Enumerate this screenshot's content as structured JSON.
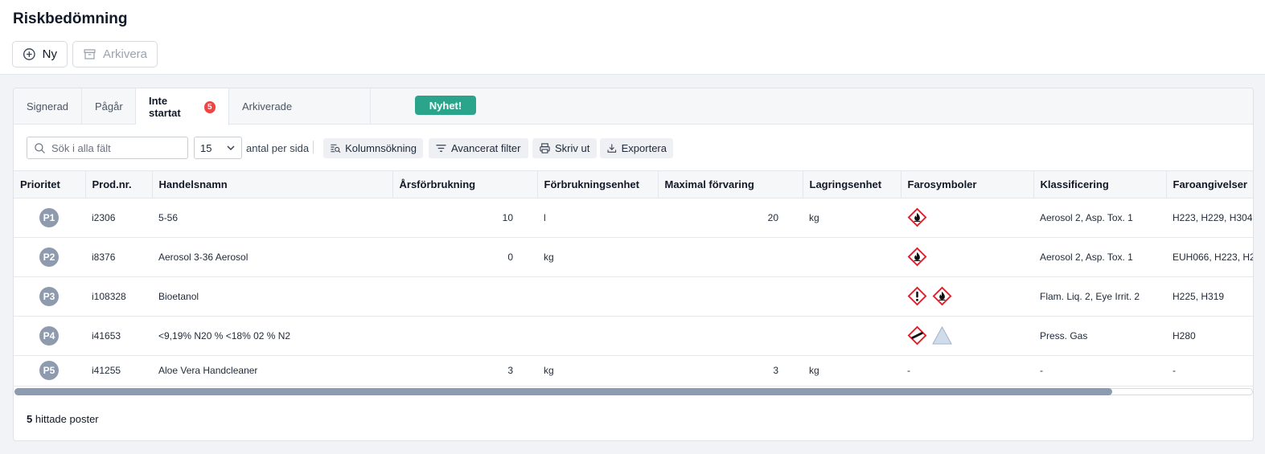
{
  "page": {
    "title": "Riskbedömning"
  },
  "actions": {
    "new_label": "Ny",
    "archive_label": "Arkivera"
  },
  "tabs": [
    {
      "label": "Signerad"
    },
    {
      "label": "Pågår"
    },
    {
      "label": "Inte startat",
      "badge": "5"
    },
    {
      "label": "Arkiverade"
    }
  ],
  "news_label": "Nyhet!",
  "toolbar": {
    "search_placeholder": "Sök i alla fält",
    "per_page_value": "15",
    "per_page_label": "antal per sida",
    "column_search": "Kolumnsökning",
    "advanced_filter": "Avancerat filter",
    "print": "Skriv ut",
    "export": "Exportera"
  },
  "table": {
    "headers": [
      "Prioritet",
      "Prod.nr.",
      "Handelsnamn",
      "Årsförbrukning",
      "Förbrukningsenhet",
      "Maximal förvaring",
      "Lagringsenhet",
      "Farosymboler",
      "Klassificering",
      "Faroangivelser"
    ],
    "rows": [
      {
        "prio": "P1",
        "prod": "i2306",
        "name": "5-56",
        "annual": "10",
        "annual_unit": "l",
        "max": "20",
        "storage_unit": "kg",
        "symbols": [
          "flame"
        ],
        "class": "Aerosol 2, Asp. Tox. 1",
        "hazards": "H223, H229, H304,"
      },
      {
        "prio": "P2",
        "prod": "i8376",
        "name": "Aerosol 3-36 Aerosol",
        "annual": "0",
        "annual_unit": "kg",
        "max": "",
        "storage_unit": "",
        "symbols": [
          "flame"
        ],
        "class": "Aerosol 2, Asp. Tox. 1",
        "hazards": "EUH066, H223, H2"
      },
      {
        "prio": "P3",
        "prod": "i108328",
        "name": "Bioetanol",
        "annual": "",
        "annual_unit": "",
        "max": "",
        "storage_unit": "",
        "symbols": [
          "exclamation",
          "flame"
        ],
        "class": "Flam. Liq. 2, Eye Irrit. 2",
        "hazards": "H225, H319"
      },
      {
        "prio": "P4",
        "prod": "i41653",
        "name": "<9,19% N20 % <18% 02 % N2",
        "annual": "",
        "annual_unit": "",
        "max": "",
        "storage_unit": "",
        "symbols": [
          "gas-cylinder",
          "triangle"
        ],
        "class": "Press. Gas",
        "hazards": "H280"
      },
      {
        "prio": "P5",
        "prod": "i41255",
        "name": "Aloe Vera Handcleaner",
        "annual": "3",
        "annual_unit": "kg",
        "max": "3",
        "storage_unit": "kg",
        "symbols_text": "-",
        "class": "-",
        "hazards": "-"
      }
    ]
  },
  "footer": {
    "count": "5",
    "label": "hittade poster"
  },
  "colors": {
    "accent": "#2aa58c",
    "badge": "#ef4444",
    "priority": "#8e9aad",
    "hazard": "#e11d2a"
  }
}
